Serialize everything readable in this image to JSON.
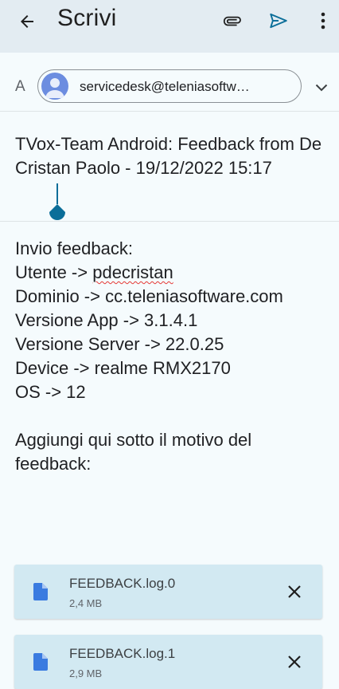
{
  "appbar": {
    "title": "Scrivi",
    "back_icon": "arrow-left-icon",
    "attach_icon": "paperclip-icon",
    "send_icon": "send-icon",
    "more_icon": "more-vertical-icon",
    "accent": "#0b6e99"
  },
  "recipient": {
    "label": "A",
    "email": "servicedesk@teleniasoftw…",
    "expand_icon": "chevron-down-icon"
  },
  "subject": {
    "text": "TVox-Team Android: Feedback from De Cristan Paolo - 19/12/2022 15:17"
  },
  "body": {
    "lines": [
      "Invio feedback:",
      "Utente -> pdecristan",
      "Dominio -> cc.teleniasoftware.com",
      "Versione App -> 3.1.4.1",
      "Versione Server -> 22.0.25",
      "Device -> realme RMX2170",
      "OS -> 12",
      "",
      "Aggiungi qui sotto il motivo del",
      "feedback:"
    ],
    "utente_prefix": "Utente -> ",
    "utente_value": "pdecristan"
  },
  "attachments": [
    {
      "name": "FEEDBACK.log.0",
      "size": "2,4 MB",
      "icon": "file-icon",
      "remove_icon": "close-icon"
    },
    {
      "name": "FEEDBACK.log.1",
      "size": "2,9 MB",
      "icon": "file-icon",
      "remove_icon": "close-icon"
    }
  ]
}
